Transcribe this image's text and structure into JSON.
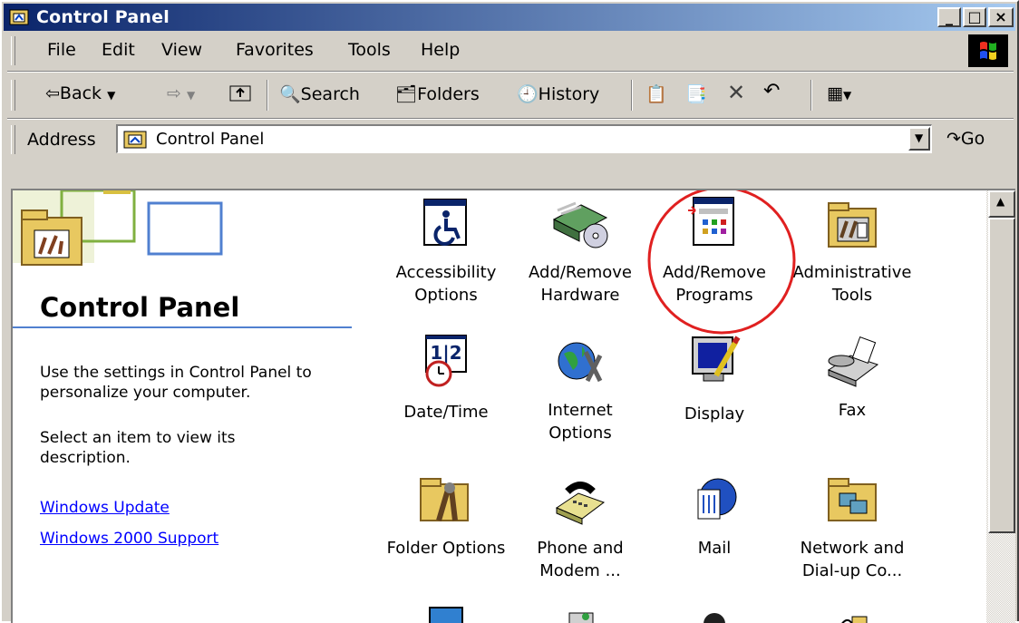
{
  "window": {
    "title": "Control Panel"
  },
  "menu": {
    "items": [
      "File",
      "Edit",
      "View",
      "Favorites",
      "Tools",
      "Help"
    ]
  },
  "toolbar": {
    "back": "Back",
    "search": "Search",
    "folders": "Folders",
    "history": "History"
  },
  "address": {
    "label": "Address",
    "value": "Control Panel",
    "go": "Go"
  },
  "panel": {
    "title": "Control Panel",
    "description": "Use the settings in Control Panel to personalize your computer.",
    "hint": "Select an item to view its description.",
    "links": [
      "Windows Update",
      "Windows 2000 Support"
    ]
  },
  "icons": [
    {
      "line1": "Accessibility",
      "line2": "Options",
      "icon": "accessibility-icon"
    },
    {
      "line1": "Add/Remove",
      "line2": "Hardware",
      "icon": "add-remove-hardware-icon"
    },
    {
      "line1": "Add/Remove",
      "line2": "Programs",
      "icon": "add-remove-programs-icon",
      "highlighted": true
    },
    {
      "line1": "Administrative",
      "line2": "Tools",
      "icon": "administrative-tools-icon"
    },
    {
      "line1": "Date/Time",
      "line2": "",
      "icon": "date-time-icon"
    },
    {
      "line1": "Internet",
      "line2": "Options",
      "icon": "internet-options-icon",
      "focused": true
    },
    {
      "line1": "Display",
      "line2": "",
      "icon": "display-icon"
    },
    {
      "line1": "Fax",
      "line2": "",
      "icon": "fax-icon"
    },
    {
      "line1": "Folder Options",
      "line2": "",
      "icon": "folder-options-icon"
    },
    {
      "line1": "Phone and",
      "line2": "Modem ...",
      "icon": "phone-modem-icon"
    },
    {
      "line1": "Mail",
      "line2": "",
      "icon": "mail-icon"
    },
    {
      "line1": "Network and",
      "line2": "Dial-up Co...",
      "icon": "network-dialup-icon"
    }
  ],
  "colors": {
    "titlebar_start": "#0a246a",
    "titlebar_end": "#a6caf0",
    "highlight_circle": "#e02020",
    "link": "#0000ff"
  }
}
